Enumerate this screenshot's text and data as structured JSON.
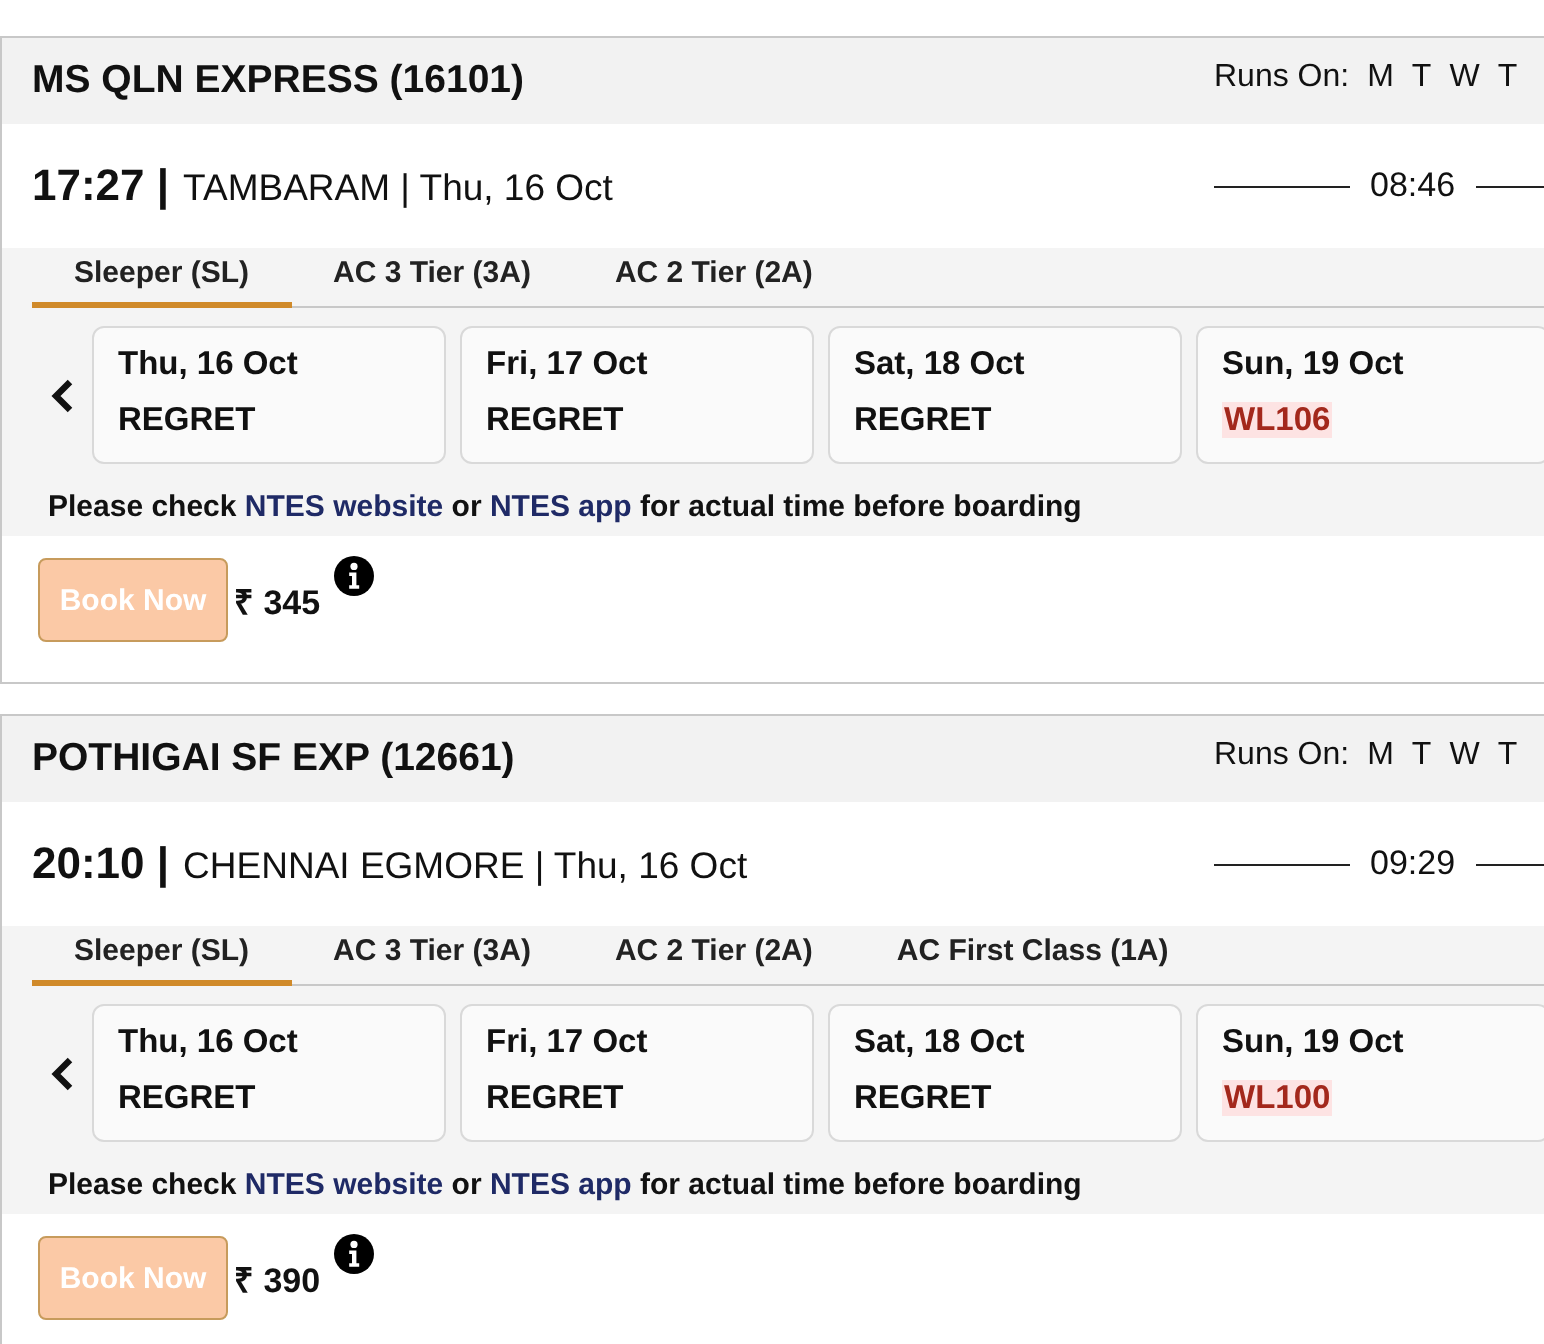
{
  "trains": [
    {
      "name": "MS QLN EXPRESS (16101)",
      "runs_on_label": "Runs On:",
      "run_days": [
        "M",
        "T",
        "W",
        "T"
      ],
      "departure_time": "17:27 |",
      "station_date": "TAMBARAM | Thu, 16 Oct",
      "duration": "08:46",
      "classes": [
        {
          "label": "Sleeper (SL)",
          "selected": true
        },
        {
          "label": "AC 3 Tier (3A)",
          "selected": false
        },
        {
          "label": "AC 2 Tier (2A)",
          "selected": false
        }
      ],
      "availability": [
        {
          "date": "Thu, 16 Oct",
          "status": "REGRET",
          "kind": "regret"
        },
        {
          "date": "Fri, 17 Oct",
          "status": "REGRET",
          "kind": "regret"
        },
        {
          "date": "Sat, 18 Oct",
          "status": "REGRET",
          "kind": "regret"
        },
        {
          "date": "Sun, 19 Oct",
          "status": "WL106",
          "kind": "waitlist"
        }
      ],
      "note": [
        {
          "text": "Please check ",
          "kind": "text"
        },
        {
          "text": "NTES website",
          "kind": "link"
        },
        {
          "text": " or ",
          "kind": "text"
        },
        {
          "text": "NTES app",
          "kind": "link"
        },
        {
          "text": " for actual time before boarding",
          "kind": "text"
        }
      ],
      "book_button": {
        "label": "Book Now",
        "disabled": true
      },
      "fare": "₹ 345"
    },
    {
      "name": "POTHIGAI SF EXP (12661)",
      "runs_on_label": "Runs On:",
      "run_days": [
        "M",
        "T",
        "W",
        "T"
      ],
      "departure_time": "20:10 |",
      "station_date": "CHENNAI EGMORE | Thu, 16 Oct",
      "duration": "09:29",
      "classes": [
        {
          "label": "Sleeper (SL)",
          "selected": true
        },
        {
          "label": "AC 3 Tier (3A)",
          "selected": false
        },
        {
          "label": "AC 2 Tier (2A)",
          "selected": false
        },
        {
          "label": "AC First Class (1A)",
          "selected": false
        }
      ],
      "availability": [
        {
          "date": "Thu, 16 Oct",
          "status": "REGRET",
          "kind": "regret"
        },
        {
          "date": "Fri, 17 Oct",
          "status": "REGRET",
          "kind": "regret"
        },
        {
          "date": "Sat, 18 Oct",
          "status": "REGRET",
          "kind": "regret"
        },
        {
          "date": "Sun, 19 Oct",
          "status": "WL100",
          "kind": "waitlist"
        }
      ],
      "note": [
        {
          "text": "Please check ",
          "kind": "text"
        },
        {
          "text": "NTES website",
          "kind": "link"
        },
        {
          "text": " or ",
          "kind": "text"
        },
        {
          "text": "NTES app",
          "kind": "link"
        },
        {
          "text": " for actual time before boarding",
          "kind": "text"
        }
      ],
      "book_button": {
        "label": "Book Now",
        "disabled": true
      },
      "fare": "₹ 390"
    }
  ]
}
